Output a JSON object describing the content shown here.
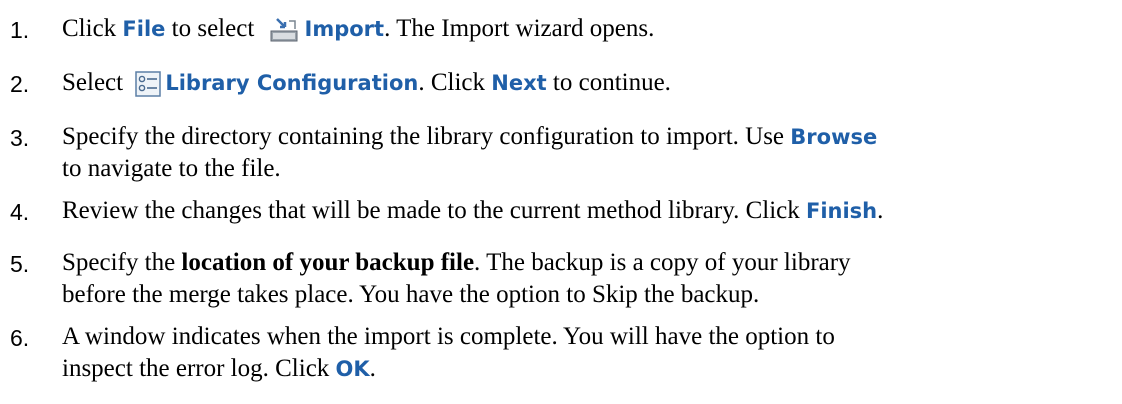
{
  "steps": [
    {
      "number": "1.",
      "parts": [
        "Click ",
        "File",
        " to select ",
        "Import",
        ".  The Import wizard opens."
      ],
      "icon": "import-icon"
    },
    {
      "number": "2.",
      "parts": [
        "Select ",
        "Library Configuration",
        ".  Click ",
        "Next",
        " to continue."
      ],
      "icon": "library-configuration-icon"
    },
    {
      "number": "3.",
      "line1": [
        "Specify the directory containing the library configuration to import.  Use ",
        "Browse"
      ],
      "line2": "to navigate to the file."
    },
    {
      "number": "4.",
      "parts": [
        "Review the changes that will be made to the current method library.  Click ",
        "Finish",
        "."
      ]
    },
    {
      "number": "5.",
      "line1": [
        "Specify the ",
        "location of your backup file",
        ".  The backup is a copy of your library"
      ],
      "line2": "before the merge takes place.  You have the option to Skip the backup."
    },
    {
      "number": "6.",
      "line1": "A window indicates when the import is complete.  You will have the option to",
      "line2": [
        "inspect the error log.  Click ",
        "OK",
        "."
      ]
    }
  ],
  "colors": {
    "ui_keyword": "#1f5fa8",
    "text": "#000000"
  }
}
